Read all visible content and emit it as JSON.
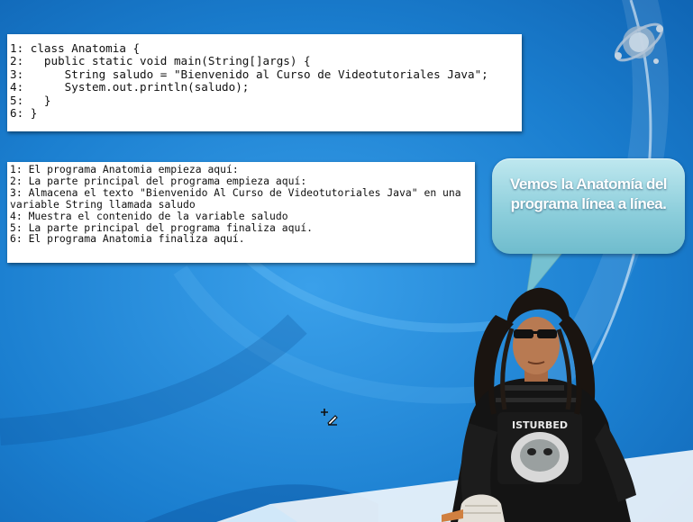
{
  "slide": {
    "code_lines": [
      "1: class Anatomia {",
      "2:   public static void main(String[]args) {",
      "3:      String saludo = \"Bienvenido al Curso de Videotutoriales Java\";",
      "4:      System.out.println(saludo);",
      "5:   }",
      "6: }"
    ],
    "explanation_lines": [
      "1: El programa Anatomia empieza aquí:",
      "2: La parte principal del programa empieza aquí:",
      "3: Almacena el texto \"Bienvenido Al Curso de Videotutoriales Java\" en una variable String llamada saludo",
      "4: Muestra el contenido de la variable saludo",
      "5: La parte principal del programa finaliza aquí.",
      "6: El programa Anatomia finaliza aquí."
    ],
    "speech_bubble_text": "Vemos la Anatomía del programa línea a línea.",
    "avatar_shirt_text": "ISTURBED"
  },
  "icons": {
    "logo": "orbital-logo-icon",
    "cursor": "move-resize-cursor-icon"
  },
  "colors": {
    "background": "#1a7fd0",
    "bubble": "#8ecfdc",
    "panel": "#ffffff"
  }
}
